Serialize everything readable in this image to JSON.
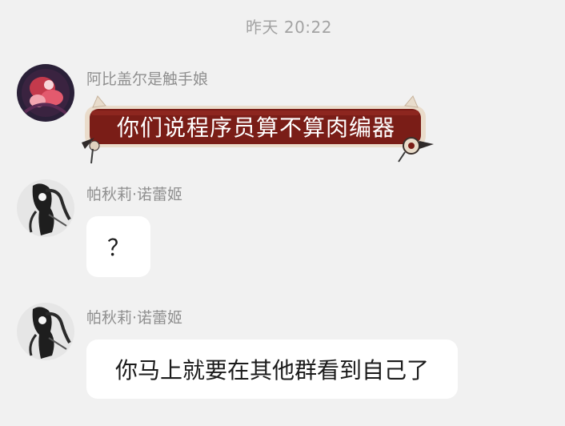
{
  "chat": {
    "timestamp": "昨天 20:22",
    "messages": [
      {
        "sender": "阿比盖尔是触手娘",
        "text": "你们说程序员算不算肉编器",
        "bubble_style": "decorated-dark-red",
        "avatar": "anime-avatar-red-pink"
      },
      {
        "sender": "帕秋莉·诺蕾姬",
        "text": "？",
        "bubble_style": "plain-white",
        "avatar": "anime-avatar-monochrome"
      },
      {
        "sender": "帕秋莉·诺蕾姬",
        "text": "你马上就要在其他群看到自己了",
        "bubble_style": "plain-white",
        "avatar": "anime-avatar-monochrome"
      }
    ]
  },
  "colors": {
    "background": "#f1f1f1",
    "bubble_white": "#ffffff",
    "bubble_special_fill": "#7a1d17",
    "bubble_special_border": "#d9c7b3",
    "sender_text": "#8f8f8f",
    "timestamp_text": "#a3a3a3"
  }
}
